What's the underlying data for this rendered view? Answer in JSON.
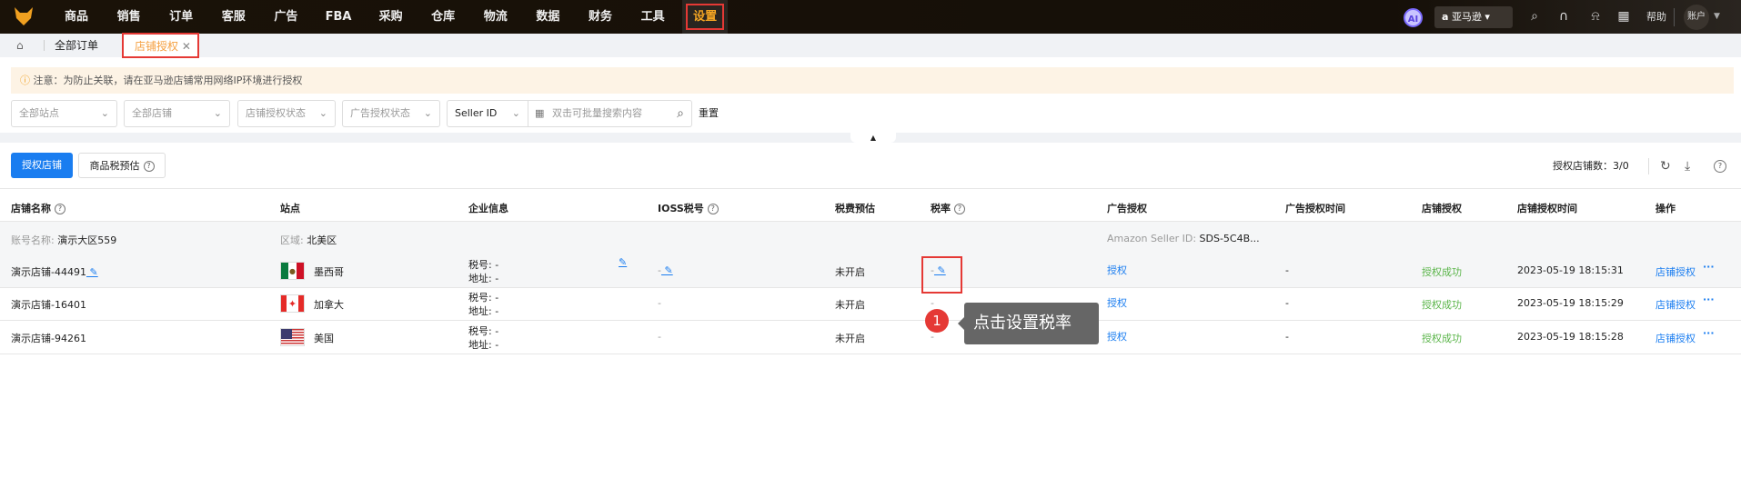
{
  "nav": {
    "items": [
      "商品",
      "销售",
      "订单",
      "客服",
      "广告",
      "FBA",
      "采购",
      "仓库",
      "物流",
      "数据",
      "财务",
      "工具",
      "设置"
    ],
    "active": "设置",
    "ai": "AI",
    "platform": "亚马逊",
    "help": "帮助",
    "account": "账户"
  },
  "tabs": {
    "all_orders": "全部订单",
    "store_auth": "店铺授权"
  },
  "notice": "注意：为防止关联，请在亚马逊店铺常用网络IP环境进行授权",
  "filters": {
    "site": "全部站点",
    "store": "全部店铺",
    "store_auth_status": "店铺授权状态",
    "ad_auth_status": "广告授权状态",
    "search_field": "Seller ID",
    "search_placeholder": "双击可批量搜索内容",
    "reset": "重置"
  },
  "toolbar": {
    "authorize_store": "授权店铺",
    "tax_estimate": "商品税预估",
    "count_label": "授权店铺数：3/0"
  },
  "table": {
    "headers": [
      "店铺名称",
      "站点",
      "企业信息",
      "IOSS税号",
      "税费预估",
      "税率",
      "广告授权",
      "广告授权时间",
      "店铺授权",
      "店铺授权时间",
      "操作"
    ],
    "group": {
      "account_label": "账号名称:",
      "account": "演示大区559",
      "region_label": "区域:",
      "region": "北美区",
      "seller_label": "Amazon Seller ID:",
      "seller_id": "SDS-5C4B..."
    },
    "rows": [
      {
        "name": "演示店铺-44491",
        "site": "墨西哥",
        "flag": "mx",
        "tax_no": "税号: -",
        "address": "地址: -",
        "ioss": "-",
        "tax_est": "未开启",
        "rate": "-",
        "ad_auth": "授权",
        "ad_time": "-",
        "store_auth": "授权成功",
        "store_time": "2023-05-19 18:15:31",
        "op": "店铺授权",
        "more": "···"
      },
      {
        "name": "演示店铺-16401",
        "site": "加拿大",
        "flag": "ca",
        "tax_no": "税号: -",
        "address": "地址: -",
        "ioss": "-",
        "tax_est": "未开启",
        "rate": "-",
        "ad_auth": "授权",
        "ad_time": "-",
        "store_auth": "授权成功",
        "store_time": "2023-05-19 18:15:29",
        "op": "店铺授权",
        "more": "···"
      },
      {
        "name": "演示店铺-94261",
        "site": "美国",
        "flag": "us",
        "tax_no": "税号: -",
        "address": "地址: -",
        "ioss": "-",
        "tax_est": "未开启",
        "rate": "-",
        "ad_auth": "授权",
        "ad_time": "-",
        "store_auth": "授权成功",
        "store_time": "2023-05-19 18:15:28",
        "op": "店铺授权",
        "more": "···"
      }
    ]
  },
  "callout": {
    "step": "1",
    "text": "点击设置税率"
  }
}
